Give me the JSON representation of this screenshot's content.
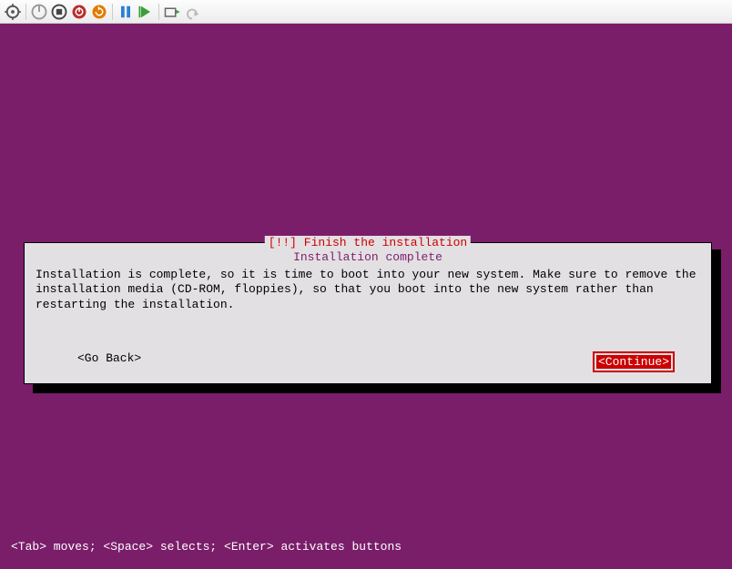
{
  "dialog": {
    "title": "[!!] Finish the installation",
    "subtitle": "Installation complete",
    "body": "Installation is complete, so it is time to boot into your new system. Make sure to remove the installation media (CD-ROM, floppies), so that you boot into the new system rather than restarting the installation.",
    "go_back": "<Go Back>",
    "continue": "<Continue>"
  },
  "footer": "<Tab> moves; <Space> selects; <Enter> activates buttons"
}
